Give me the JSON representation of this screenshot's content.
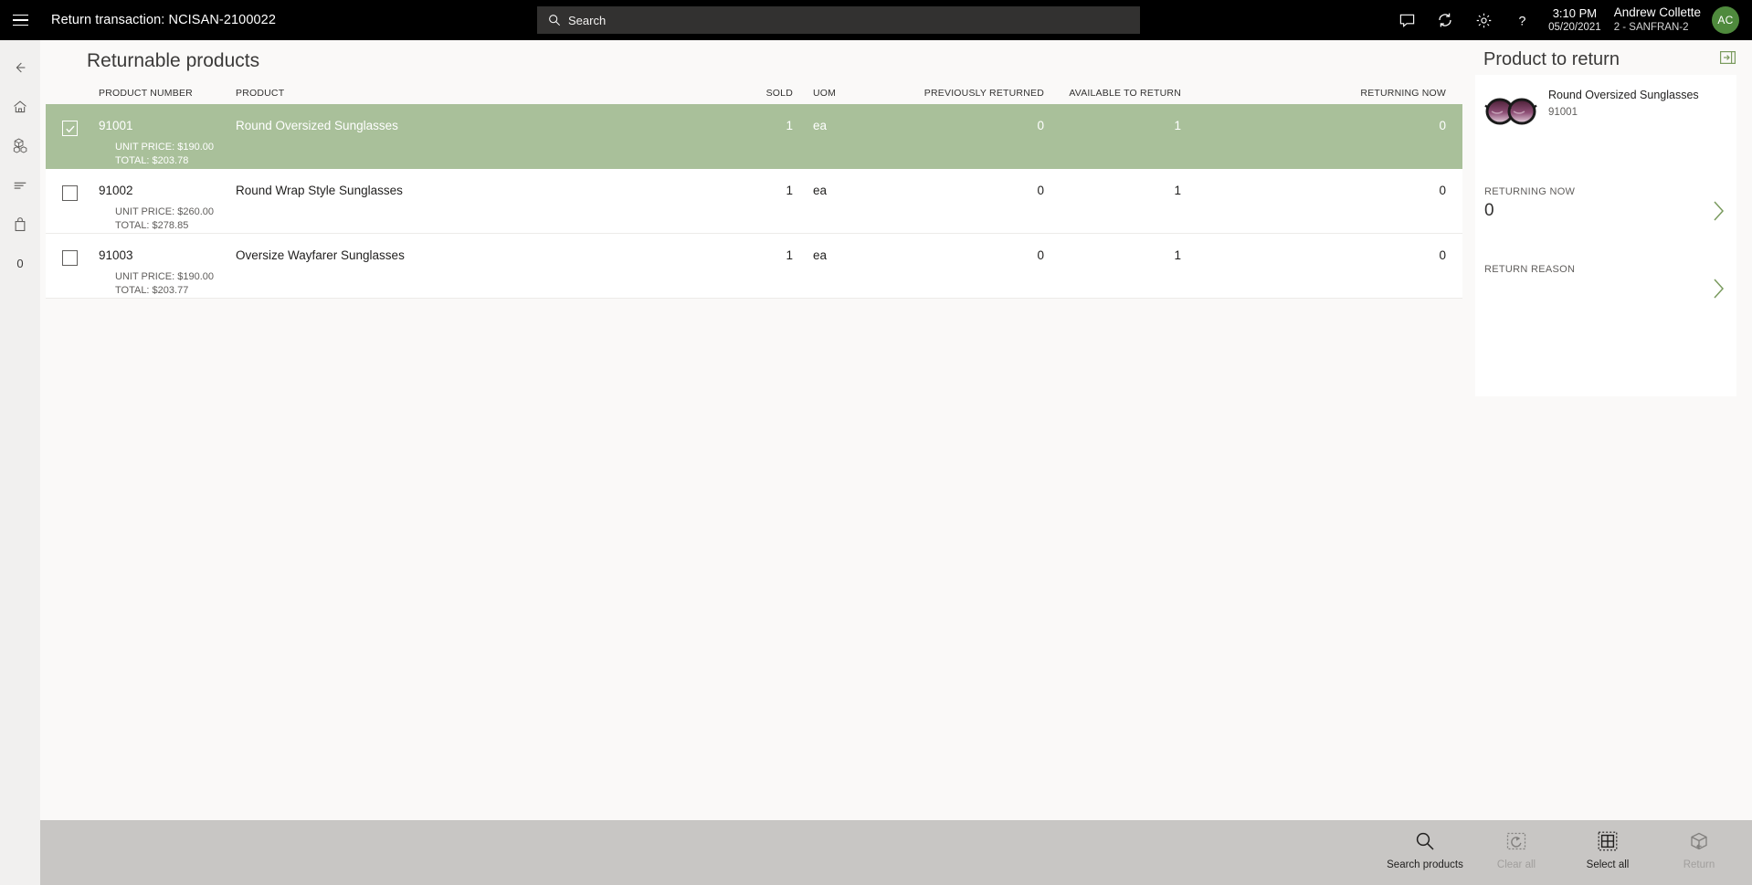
{
  "topbar": {
    "title": "Return transaction: NCISAN-2100022",
    "search_placeholder": "Search",
    "time": "3:10 PM",
    "date": "05/20/2021",
    "user_name": "Andrew Collette",
    "user_store": "2 - SANFRAN-2",
    "avatar_initials": "AC",
    "icons": [
      "menu-icon",
      "search-icon",
      "message-icon",
      "sync-icon",
      "settings-icon",
      "help-icon"
    ]
  },
  "sidebar": {
    "items": [
      {
        "name": "back-icon",
        "label": ""
      },
      {
        "name": "home-icon",
        "label": ""
      },
      {
        "name": "products-icon",
        "label": ""
      },
      {
        "name": "list-icon",
        "label": ""
      },
      {
        "name": "bag-icon",
        "label": ""
      },
      {
        "name": "cart-count",
        "label": "0"
      }
    ]
  },
  "main": {
    "page_title": "Returnable products",
    "columns": [
      "PRODUCT NUMBER",
      "PRODUCT",
      "SOLD",
      "UOM",
      "PREVIOUSLY RETURNED",
      "AVAILABLE TO RETURN",
      "RETURNING NOW"
    ],
    "rows": [
      {
        "selected": true,
        "product_number": "91001",
        "product": "Round Oversized Sunglasses",
        "sold": "1",
        "uom": "ea",
        "previously_returned": "0",
        "available_to_return": "1",
        "returning_now": "0",
        "unit_price": "UNIT PRICE: $190.00",
        "total": "TOTAL: $203.78"
      },
      {
        "selected": false,
        "product_number": "91002",
        "product": "Round Wrap Style Sunglasses",
        "sold": "1",
        "uom": "ea",
        "previously_returned": "0",
        "available_to_return": "1",
        "returning_now": "0",
        "unit_price": "UNIT PRICE: $260.00",
        "total": "TOTAL: $278.85"
      },
      {
        "selected": false,
        "product_number": "91003",
        "product": "Oversize Wayfarer Sunglasses",
        "sold": "1",
        "uom": "ea",
        "previously_returned": "0",
        "available_to_return": "1",
        "returning_now": "0",
        "unit_price": "UNIT PRICE: $190.00",
        "total": "TOTAL: $203.77"
      }
    ]
  },
  "right_panel": {
    "title": "Product to return",
    "expand_icon": "collapse-panel-icon",
    "product_name": "Round Oversized Sunglasses",
    "product_number": "91001",
    "product_image": "sunglasses-thumbnail",
    "returning_now_label": "RETURNING NOW",
    "returning_now_value": "0",
    "return_reason_label": "RETURN REASON",
    "return_reason_value": "",
    "chevron_icon": "chevron-right-icon"
  },
  "bottom_toolbar": {
    "buttons": [
      {
        "label": "Search products",
        "icon": "search-icon",
        "disabled": false
      },
      {
        "label": "Clear all",
        "icon": "clear-all-icon",
        "disabled": true
      },
      {
        "label": "Select all",
        "icon": "select-all-icon",
        "disabled": false
      },
      {
        "label": "Return",
        "icon": "return-box-icon",
        "disabled": true
      }
    ]
  },
  "colors": {
    "topbar_bg": "#000000",
    "selected_row": "#a9c09a",
    "accent_green": "#7a9b5e",
    "toolbar_bg": "#c8c6c4",
    "page_bg": "#faf9f8",
    "avatar": "#4f8a3d"
  }
}
